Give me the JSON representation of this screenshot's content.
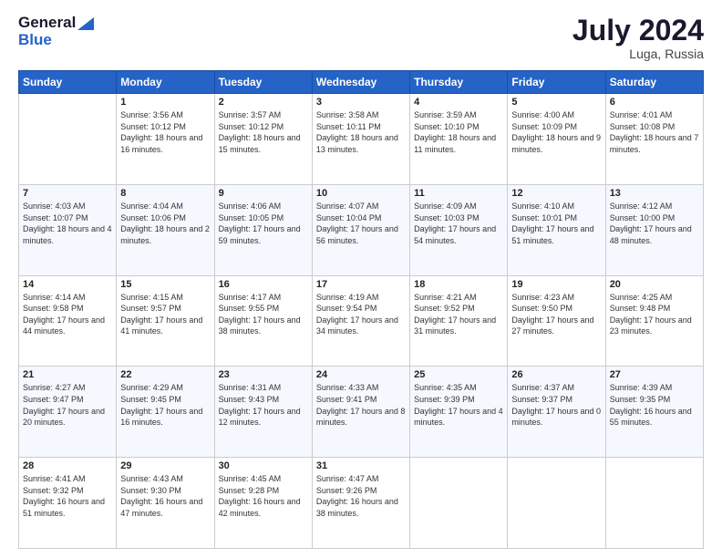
{
  "header": {
    "logo_line1": "General",
    "logo_line2": "Blue",
    "month_title": "July 2024",
    "location": "Luga, Russia"
  },
  "days_of_week": [
    "Sunday",
    "Monday",
    "Tuesday",
    "Wednesday",
    "Thursday",
    "Friday",
    "Saturday"
  ],
  "weeks": [
    [
      {
        "day": "",
        "sunrise": "",
        "sunset": "",
        "daylight": ""
      },
      {
        "day": "1",
        "sunrise": "Sunrise: 3:56 AM",
        "sunset": "Sunset: 10:12 PM",
        "daylight": "Daylight: 18 hours and 16 minutes."
      },
      {
        "day": "2",
        "sunrise": "Sunrise: 3:57 AM",
        "sunset": "Sunset: 10:12 PM",
        "daylight": "Daylight: 18 hours and 15 minutes."
      },
      {
        "day": "3",
        "sunrise": "Sunrise: 3:58 AM",
        "sunset": "Sunset: 10:11 PM",
        "daylight": "Daylight: 18 hours and 13 minutes."
      },
      {
        "day": "4",
        "sunrise": "Sunrise: 3:59 AM",
        "sunset": "Sunset: 10:10 PM",
        "daylight": "Daylight: 18 hours and 11 minutes."
      },
      {
        "day": "5",
        "sunrise": "Sunrise: 4:00 AM",
        "sunset": "Sunset: 10:09 PM",
        "daylight": "Daylight: 18 hours and 9 minutes."
      },
      {
        "day": "6",
        "sunrise": "Sunrise: 4:01 AM",
        "sunset": "Sunset: 10:08 PM",
        "daylight": "Daylight: 18 hours and 7 minutes."
      }
    ],
    [
      {
        "day": "7",
        "sunrise": "Sunrise: 4:03 AM",
        "sunset": "Sunset: 10:07 PM",
        "daylight": "Daylight: 18 hours and 4 minutes."
      },
      {
        "day": "8",
        "sunrise": "Sunrise: 4:04 AM",
        "sunset": "Sunset: 10:06 PM",
        "daylight": "Daylight: 18 hours and 2 minutes."
      },
      {
        "day": "9",
        "sunrise": "Sunrise: 4:06 AM",
        "sunset": "Sunset: 10:05 PM",
        "daylight": "Daylight: 17 hours and 59 minutes."
      },
      {
        "day": "10",
        "sunrise": "Sunrise: 4:07 AM",
        "sunset": "Sunset: 10:04 PM",
        "daylight": "Daylight: 17 hours and 56 minutes."
      },
      {
        "day": "11",
        "sunrise": "Sunrise: 4:09 AM",
        "sunset": "Sunset: 10:03 PM",
        "daylight": "Daylight: 17 hours and 54 minutes."
      },
      {
        "day": "12",
        "sunrise": "Sunrise: 4:10 AM",
        "sunset": "Sunset: 10:01 PM",
        "daylight": "Daylight: 17 hours and 51 minutes."
      },
      {
        "day": "13",
        "sunrise": "Sunrise: 4:12 AM",
        "sunset": "Sunset: 10:00 PM",
        "daylight": "Daylight: 17 hours and 48 minutes."
      }
    ],
    [
      {
        "day": "14",
        "sunrise": "Sunrise: 4:14 AM",
        "sunset": "Sunset: 9:58 PM",
        "daylight": "Daylight: 17 hours and 44 minutes."
      },
      {
        "day": "15",
        "sunrise": "Sunrise: 4:15 AM",
        "sunset": "Sunset: 9:57 PM",
        "daylight": "Daylight: 17 hours and 41 minutes."
      },
      {
        "day": "16",
        "sunrise": "Sunrise: 4:17 AM",
        "sunset": "Sunset: 9:55 PM",
        "daylight": "Daylight: 17 hours and 38 minutes."
      },
      {
        "day": "17",
        "sunrise": "Sunrise: 4:19 AM",
        "sunset": "Sunset: 9:54 PM",
        "daylight": "Daylight: 17 hours and 34 minutes."
      },
      {
        "day": "18",
        "sunrise": "Sunrise: 4:21 AM",
        "sunset": "Sunset: 9:52 PM",
        "daylight": "Daylight: 17 hours and 31 minutes."
      },
      {
        "day": "19",
        "sunrise": "Sunrise: 4:23 AM",
        "sunset": "Sunset: 9:50 PM",
        "daylight": "Daylight: 17 hours and 27 minutes."
      },
      {
        "day": "20",
        "sunrise": "Sunrise: 4:25 AM",
        "sunset": "Sunset: 9:48 PM",
        "daylight": "Daylight: 17 hours and 23 minutes."
      }
    ],
    [
      {
        "day": "21",
        "sunrise": "Sunrise: 4:27 AM",
        "sunset": "Sunset: 9:47 PM",
        "daylight": "Daylight: 17 hours and 20 minutes."
      },
      {
        "day": "22",
        "sunrise": "Sunrise: 4:29 AM",
        "sunset": "Sunset: 9:45 PM",
        "daylight": "Daylight: 17 hours and 16 minutes."
      },
      {
        "day": "23",
        "sunrise": "Sunrise: 4:31 AM",
        "sunset": "Sunset: 9:43 PM",
        "daylight": "Daylight: 17 hours and 12 minutes."
      },
      {
        "day": "24",
        "sunrise": "Sunrise: 4:33 AM",
        "sunset": "Sunset: 9:41 PM",
        "daylight": "Daylight: 17 hours and 8 minutes."
      },
      {
        "day": "25",
        "sunrise": "Sunrise: 4:35 AM",
        "sunset": "Sunset: 9:39 PM",
        "daylight": "Daylight: 17 hours and 4 minutes."
      },
      {
        "day": "26",
        "sunrise": "Sunrise: 4:37 AM",
        "sunset": "Sunset: 9:37 PM",
        "daylight": "Daylight: 17 hours and 0 minutes."
      },
      {
        "day": "27",
        "sunrise": "Sunrise: 4:39 AM",
        "sunset": "Sunset: 9:35 PM",
        "daylight": "Daylight: 16 hours and 55 minutes."
      }
    ],
    [
      {
        "day": "28",
        "sunrise": "Sunrise: 4:41 AM",
        "sunset": "Sunset: 9:32 PM",
        "daylight": "Daylight: 16 hours and 51 minutes."
      },
      {
        "day": "29",
        "sunrise": "Sunrise: 4:43 AM",
        "sunset": "Sunset: 9:30 PM",
        "daylight": "Daylight: 16 hours and 47 minutes."
      },
      {
        "day": "30",
        "sunrise": "Sunrise: 4:45 AM",
        "sunset": "Sunset: 9:28 PM",
        "daylight": "Daylight: 16 hours and 42 minutes."
      },
      {
        "day": "31",
        "sunrise": "Sunrise: 4:47 AM",
        "sunset": "Sunset: 9:26 PM",
        "daylight": "Daylight: 16 hours and 38 minutes."
      },
      {
        "day": "",
        "sunrise": "",
        "sunset": "",
        "daylight": ""
      },
      {
        "day": "",
        "sunrise": "",
        "sunset": "",
        "daylight": ""
      },
      {
        "day": "",
        "sunrise": "",
        "sunset": "",
        "daylight": ""
      }
    ]
  ]
}
